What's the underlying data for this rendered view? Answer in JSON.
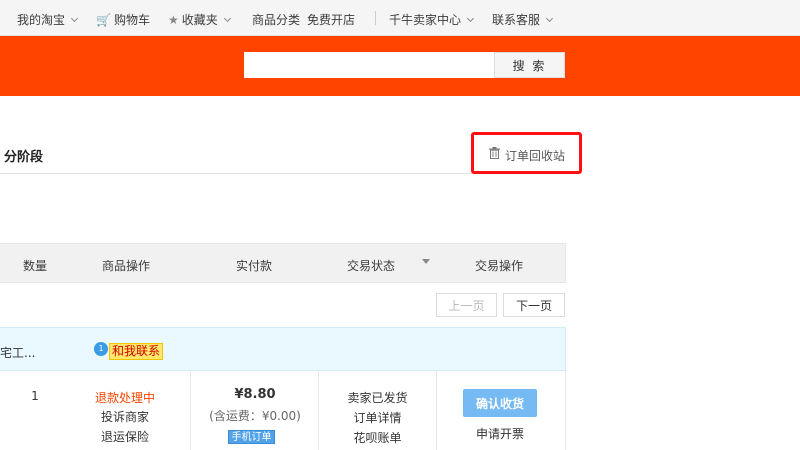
{
  "topnav": {
    "my_taobao": "我的淘宝",
    "cart": "购物车",
    "favorites": "收藏夹",
    "categories": "商品分类",
    "open_store": "免费开店",
    "seller_center": "千牛卖家中心",
    "customer_service": "联系客服"
  },
  "search": {
    "button": "搜 索",
    "placeholder": ""
  },
  "section": {
    "title": "分阶段",
    "recycle_bin": "订单回收站"
  },
  "table": {
    "headers": [
      "数量",
      "商品操作",
      "实付款",
      "交易状态",
      "交易操作"
    ]
  },
  "pager": {
    "prev": "上一页",
    "next": "下一页"
  },
  "order": {
    "shop_name": "宅工...",
    "chat_label": "和我联系",
    "chat_badge": "1",
    "quantity": "1",
    "refund_status": "退款处理中",
    "complain": "投诉商家",
    "return_insurance": "退运保险",
    "price": "¥8.80",
    "freight": "(含运费：¥0.00)",
    "mobile_order": "手机订单",
    "status_shipped": "卖家已发货",
    "order_detail": "订单详情",
    "huabei_bill": "花呗账单",
    "confirm_button": "确认收货",
    "invoice": "申请开票"
  },
  "colors": {
    "brand": "#ff4400",
    "highlight_box": "#ff1010",
    "confirm_button": "#75baf2"
  }
}
